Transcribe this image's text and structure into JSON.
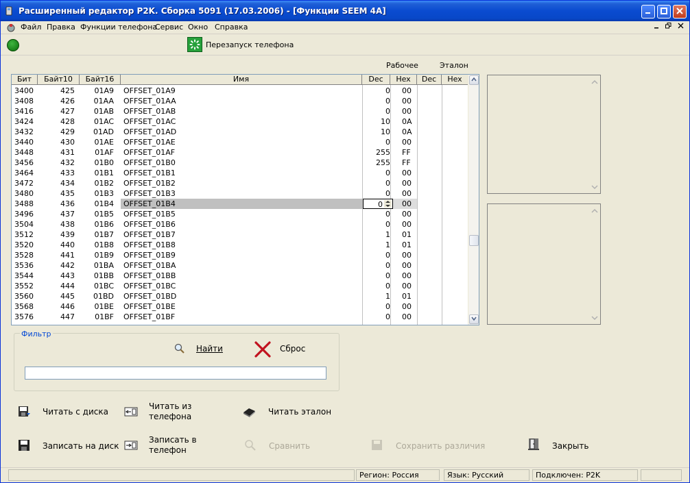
{
  "window": {
    "title": "Расширенный редактор P2K. Сборка 5091 (17.03.2006) - [Функции SEEM 4A]"
  },
  "menu": {
    "items": [
      "Файл",
      "Правка",
      "Функции телефона",
      "Сервис",
      "Окно",
      "Справка"
    ]
  },
  "toolbar": {
    "restart_label": "Перезапуск телефона"
  },
  "groups": {
    "working": "Рабочее",
    "reference": "Эталон"
  },
  "grid": {
    "columns": [
      "Бит",
      "Байт10",
      "Байт16",
      "Имя",
      "Dec",
      "Hex",
      "Dec",
      "Hex"
    ],
    "rows": [
      {
        "bit": "3400",
        "b10": "425",
        "b16": "01A9",
        "name": "OFFSET_01A9",
        "dec": "0",
        "hex": "00"
      },
      {
        "bit": "3408",
        "b10": "426",
        "b16": "01AA",
        "name": "OFFSET_01AA",
        "dec": "0",
        "hex": "00"
      },
      {
        "bit": "3416",
        "b10": "427",
        "b16": "01AB",
        "name": "OFFSET_01AB",
        "dec": "0",
        "hex": "00"
      },
      {
        "bit": "3424",
        "b10": "428",
        "b16": "01AC",
        "name": "OFFSET_01AC",
        "dec": "10",
        "hex": "0A"
      },
      {
        "bit": "3432",
        "b10": "429",
        "b16": "01AD",
        "name": "OFFSET_01AD",
        "dec": "10",
        "hex": "0A"
      },
      {
        "bit": "3440",
        "b10": "430",
        "b16": "01AE",
        "name": "OFFSET_01AE",
        "dec": "0",
        "hex": "00"
      },
      {
        "bit": "3448",
        "b10": "431",
        "b16": "01AF",
        "name": "OFFSET_01AF",
        "dec": "255",
        "hex": "FF"
      },
      {
        "bit": "3456",
        "b10": "432",
        "b16": "01B0",
        "name": "OFFSET_01B0",
        "dec": "255",
        "hex": "FF"
      },
      {
        "bit": "3464",
        "b10": "433",
        "b16": "01B1",
        "name": "OFFSET_01B1",
        "dec": "0",
        "hex": "00"
      },
      {
        "bit": "3472",
        "b10": "434",
        "b16": "01B2",
        "name": "OFFSET_01B2",
        "dec": "0",
        "hex": "00"
      },
      {
        "bit": "3480",
        "b10": "435",
        "b16": "01B3",
        "name": "OFFSET_01B3",
        "dec": "0",
        "hex": "00"
      },
      {
        "bit": "3488",
        "b10": "436",
        "b16": "01B4",
        "name": "OFFSET_01B4",
        "dec": "0",
        "hex": "00"
      },
      {
        "bit": "3496",
        "b10": "437",
        "b16": "01B5",
        "name": "OFFSET_01B5",
        "dec": "0",
        "hex": "00"
      },
      {
        "bit": "3504",
        "b10": "438",
        "b16": "01B6",
        "name": "OFFSET_01B6",
        "dec": "0",
        "hex": "00"
      },
      {
        "bit": "3512",
        "b10": "439",
        "b16": "01B7",
        "name": "OFFSET_01B7",
        "dec": "1",
        "hex": "01"
      },
      {
        "bit": "3520",
        "b10": "440",
        "b16": "01B8",
        "name": "OFFSET_01B8",
        "dec": "1",
        "hex": "01"
      },
      {
        "bit": "3528",
        "b10": "441",
        "b16": "01B9",
        "name": "OFFSET_01B9",
        "dec": "0",
        "hex": "00"
      },
      {
        "bit": "3536",
        "b10": "442",
        "b16": "01BA",
        "name": "OFFSET_01BA",
        "dec": "0",
        "hex": "00"
      },
      {
        "bit": "3544",
        "b10": "443",
        "b16": "01BB",
        "name": "OFFSET_01BB",
        "dec": "0",
        "hex": "00"
      },
      {
        "bit": "3552",
        "b10": "444",
        "b16": "01BC",
        "name": "OFFSET_01BC",
        "dec": "0",
        "hex": "00"
      },
      {
        "bit": "3560",
        "b10": "445",
        "b16": "01BD",
        "name": "OFFSET_01BD",
        "dec": "1",
        "hex": "01"
      },
      {
        "bit": "3568",
        "b10": "446",
        "b16": "01BE",
        "name": "OFFSET_01BE",
        "dec": "0",
        "hex": "00"
      },
      {
        "bit": "3576",
        "b10": "447",
        "b16": "01BF",
        "name": "OFFSET_01BF",
        "dec": "0",
        "hex": "00"
      }
    ],
    "selected_index": 11
  },
  "filter": {
    "legend": "Фильтр",
    "find_label": "Найти",
    "reset_label": "Сброс",
    "input_value": ""
  },
  "actions": {
    "read_disk": "Читать с диска",
    "read_phone": "Читать из телефона",
    "read_reference": "Читать эталон",
    "write_disk": "Записать на диск",
    "write_phone": "Записать в телефон",
    "compare": "Сравнить",
    "save_diff": "Сохранить различия",
    "close": "Закрыть"
  },
  "statusbar": {
    "region": "Регион: Россия",
    "language": "Язык: Русский",
    "connected": "Подключен: P2K"
  },
  "colors": {
    "accent": "#0046d5",
    "ok": "#0b6d0b",
    "danger": "#c1121f"
  }
}
